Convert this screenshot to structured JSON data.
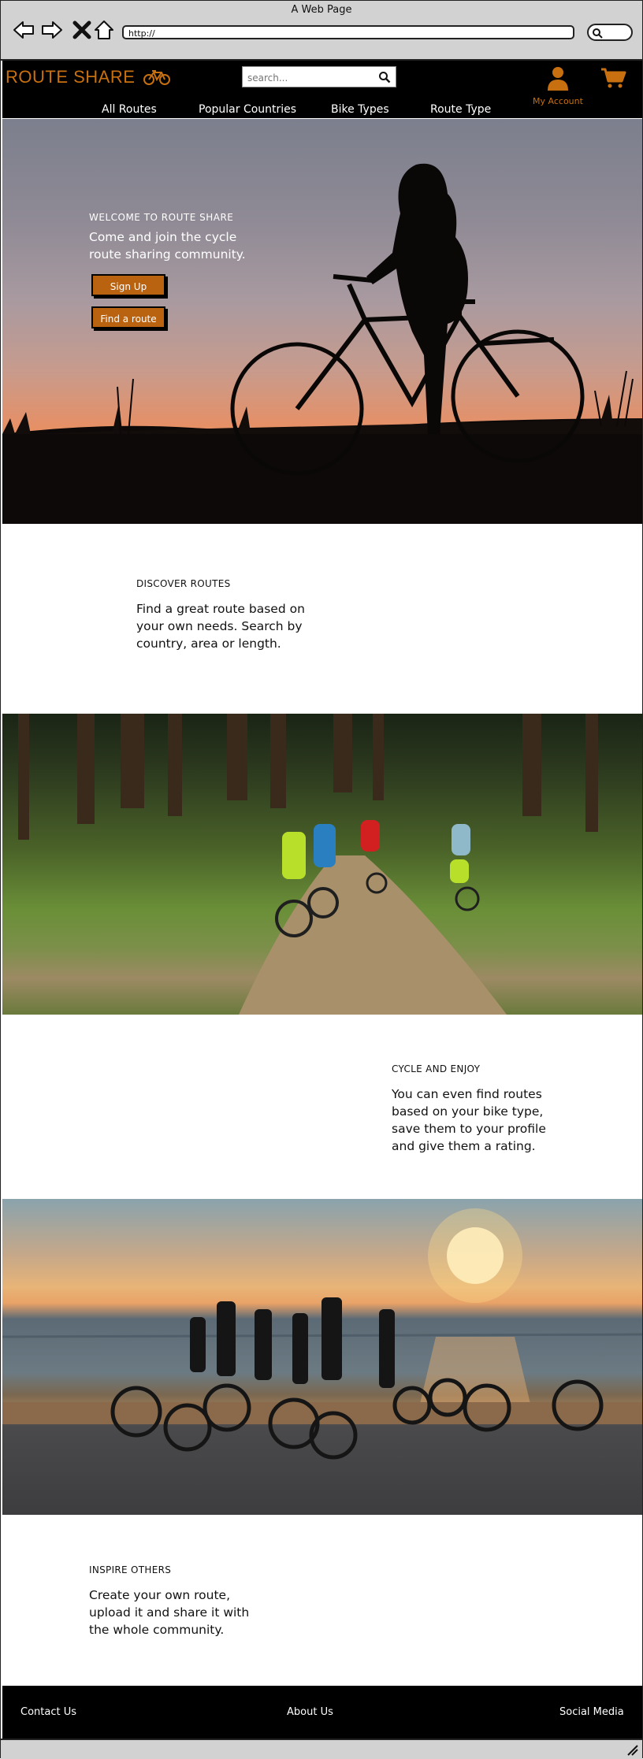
{
  "browser": {
    "window_title": "A Web Page",
    "url": "http://"
  },
  "site": {
    "logo_text": "ROUTE SHARE",
    "search_placeholder": "search...",
    "account_label": "My Account",
    "nav": [
      "All Routes",
      "Popular Countries",
      "Bike Types",
      "Route Type"
    ]
  },
  "hero": {
    "kicker": "WELCOME TO ROUTE SHARE",
    "lead": "Come and join the cycle route sharing community.",
    "buttons": {
      "signup": "Sign Up",
      "find_route": "Find a route"
    }
  },
  "sections": [
    {
      "kicker": "DISCOVER ROUTES",
      "body": "Find a great route based on your own needs. Search by country, area or length."
    },
    {
      "kicker": "CYCLE AND ENJOY",
      "body": "You can even find routes based on your bike type, save them to your profile and give them a rating."
    },
    {
      "kicker": "INSPIRE OTHERS",
      "body": "Create your own route, upload it and share it with the whole community."
    }
  ],
  "footer": {
    "links": [
      "Contact Us",
      "About Us",
      "Social Media"
    ]
  },
  "colors": {
    "brand_orange": "#c8700f",
    "button_orange": "#b9620f",
    "header_black": "#000000",
    "chrome_gray": "#d2d2d2"
  },
  "icons": {
    "back": "back-arrow-icon",
    "forward": "forward-arrow-icon",
    "close": "close-icon",
    "home": "home-icon",
    "search": "search-icon",
    "bike": "bicycle-icon",
    "account": "user-icon",
    "cart": "cart-icon"
  }
}
